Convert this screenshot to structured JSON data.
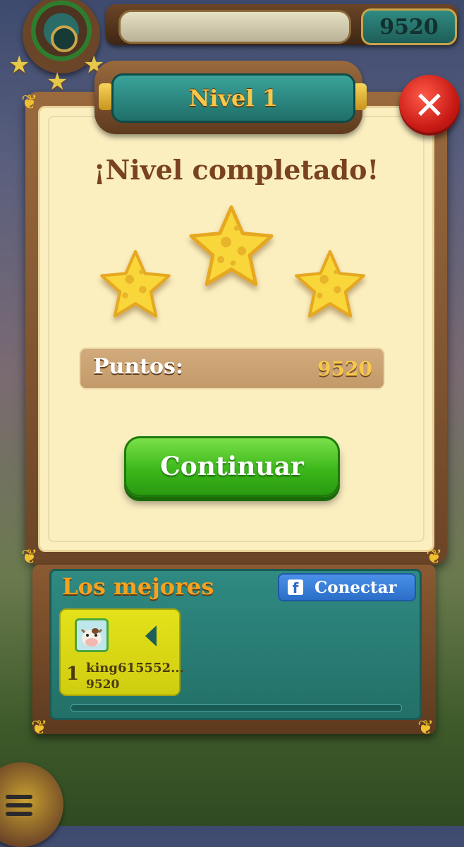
{
  "hud": {
    "score": "9520"
  },
  "dialog": {
    "title": "Nivel 1",
    "headline": "¡Nivel completado!",
    "stars_earned": 3,
    "stars_total": 3,
    "points_label": "Puntos:",
    "points_value": "9520",
    "continue_label": "Continuar",
    "close_symbol": "✕"
  },
  "leaderboard": {
    "title": "Los mejores",
    "connect_label": "Conectar",
    "connect_icon": "facebook-icon",
    "entries": [
      {
        "rank": "1",
        "name": "king615552...",
        "score": "9520"
      }
    ]
  },
  "colors": {
    "panel": "#fbefc0",
    "title_text": "#f7c84a",
    "headline_text": "#7a4320",
    "continue_button": "#3cb81a",
    "close_button": "#c81a14",
    "leaderboard_bg": "#2f8a82",
    "player_card": "#e4e21a",
    "facebook_button": "#2a6ec8"
  }
}
